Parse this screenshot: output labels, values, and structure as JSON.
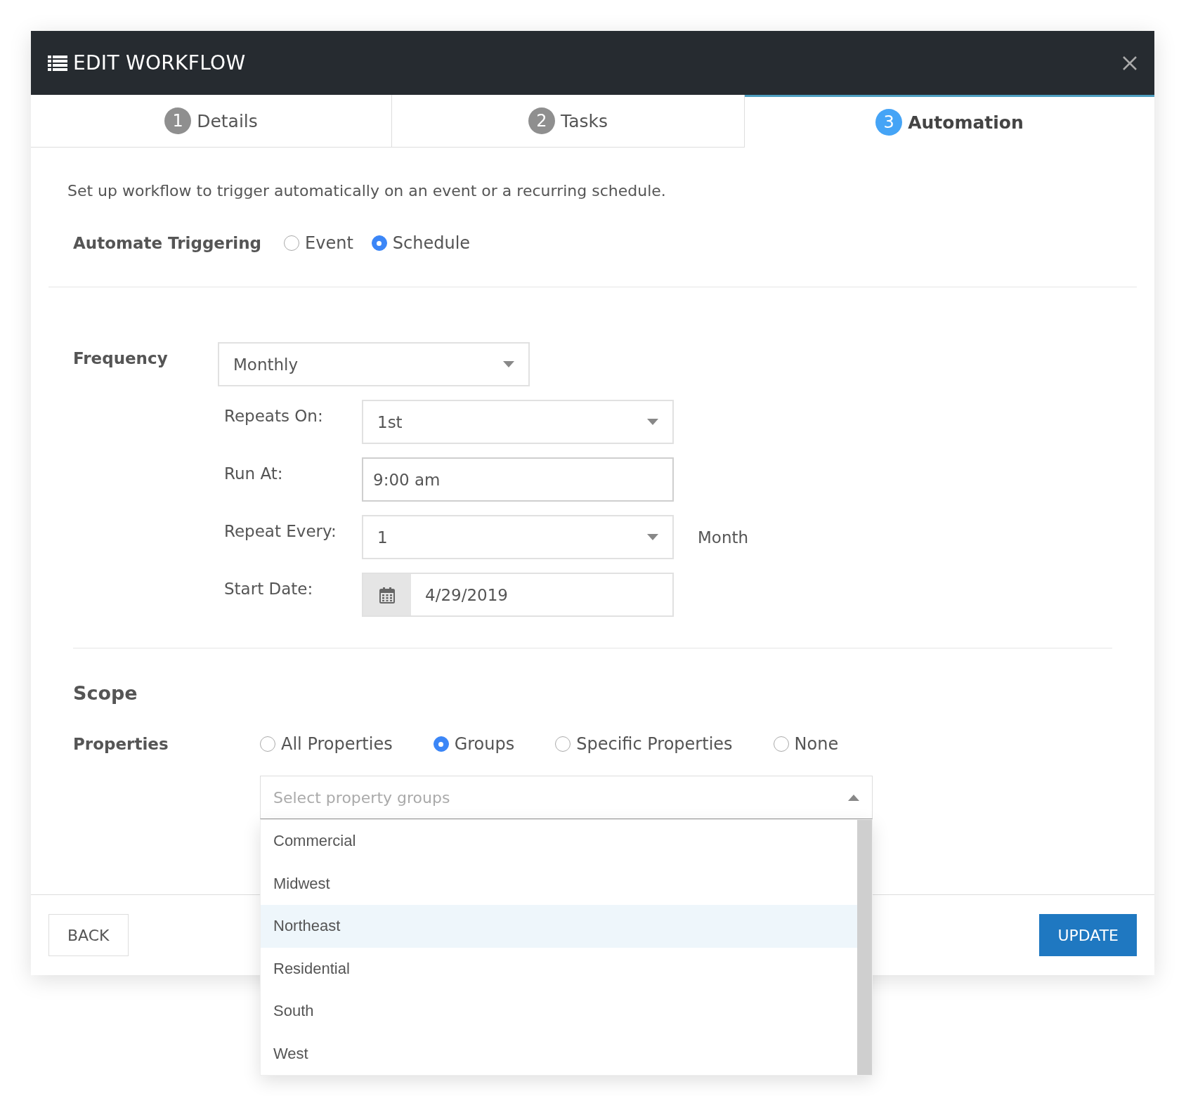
{
  "dialog": {
    "title": "EDIT WORKFLOW"
  },
  "tabs": [
    {
      "number": "1",
      "label": "Details",
      "selected": false
    },
    {
      "number": "2",
      "label": "Tasks",
      "selected": false
    },
    {
      "number": "3",
      "label": "Automation",
      "selected": true
    }
  ],
  "description": "Set up workflow to trigger automatically on an event or a recurring schedule.",
  "trigger": {
    "label": "Automate Triggering",
    "options": [
      {
        "label": "Event",
        "selected": false
      },
      {
        "label": "Schedule",
        "selected": true
      }
    ]
  },
  "frequency": {
    "label": "Frequency",
    "value": "Monthly"
  },
  "schedule_fields": [
    {
      "kind": "select",
      "label": "Repeats On:",
      "value": "1st"
    },
    {
      "kind": "text",
      "label": "Run At:",
      "value": "9:00 am"
    },
    {
      "kind": "select",
      "label": "Repeat Every:",
      "value": "1",
      "suffix": "Month"
    },
    {
      "kind": "date",
      "label": "Start Date:",
      "value": "4/29/2019"
    }
  ],
  "scope": {
    "heading": "Scope",
    "properties_label": "Properties",
    "options": [
      {
        "label": "All Properties",
        "selected": false
      },
      {
        "label": "Groups",
        "selected": true
      },
      {
        "label": "Specific Properties",
        "selected": false
      },
      {
        "label": "None",
        "selected": false
      }
    ],
    "group_select": {
      "placeholder": "Select property groups",
      "expanded": true,
      "options": [
        {
          "label": "Commercial",
          "selected": false
        },
        {
          "label": "Midwest",
          "selected": false
        },
        {
          "label": "Northeast",
          "selected": true
        },
        {
          "label": "Residential",
          "selected": false
        },
        {
          "label": "South",
          "selected": false
        },
        {
          "label": "West",
          "selected": false
        }
      ]
    }
  },
  "buttons": [
    {
      "kind": "secondary",
      "label": "BACK"
    },
    {
      "kind": "primary",
      "label": "UPDATE"
    }
  ]
}
